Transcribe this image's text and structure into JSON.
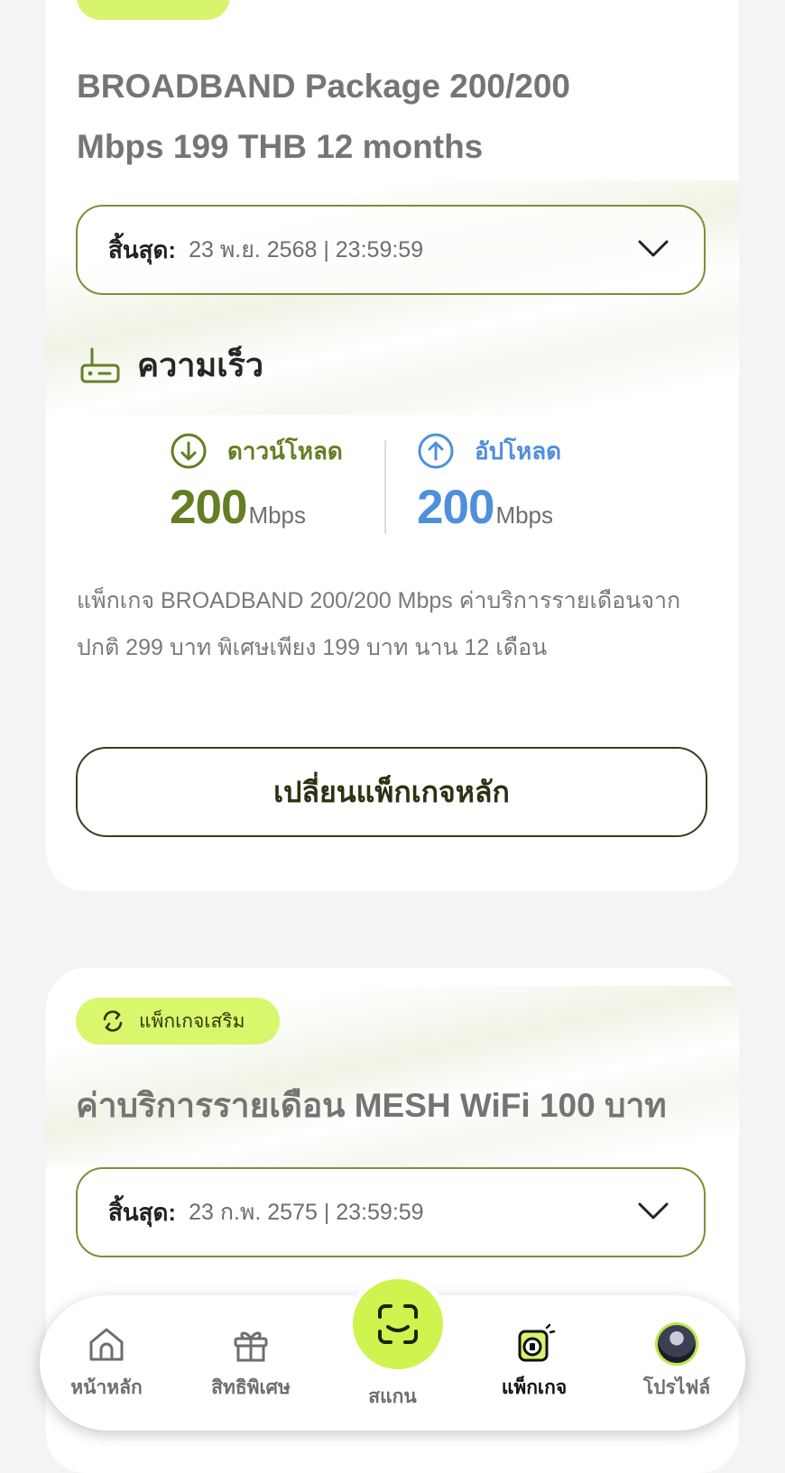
{
  "main_package": {
    "title": "BROADBAND Package 200/200 Mbps 199 THB 12 months",
    "expiry_label": "สิ้นสุด:",
    "expiry_value": "23 พ.ย. 2568 | 23:59:59",
    "speed_heading": "ความเร็ว",
    "download": {
      "label": "ดาวน์โหลด",
      "value": "200",
      "unit": "Mbps"
    },
    "upload": {
      "label": "อัปโหลด",
      "value": "200",
      "unit": "Mbps"
    },
    "description": "แพ็กเกจ BROADBAND 200/200 Mbps ค่าบริการรายเดือนจากปกติ 299 บาท พิเศษเพียง 199 บาท นาน 12 เดือน",
    "change_button": "เปลี่ยนแพ็กเกจหลัก"
  },
  "addon_package": {
    "badge": "แพ็กเกจเสริม",
    "title": "ค่าบริการรายเดือน MESH WiFi 100 บาท",
    "expiry_label": "สิ้นสุด:",
    "expiry_value": "23 ก.พ. 2575 | 23:59:59"
  },
  "nav": {
    "home": "หน้าหลัก",
    "privileges": "สิทธิพิเศษ",
    "scan": "สแกน",
    "packages": "แพ็กเกจ",
    "profile": "โปรไฟล์",
    "active": "packages"
  },
  "colors": {
    "accent_lime": "#d6f56c",
    "download_green": "#647e23",
    "upload_blue": "#4f8fdc",
    "border_olive": "#7c9035"
  }
}
